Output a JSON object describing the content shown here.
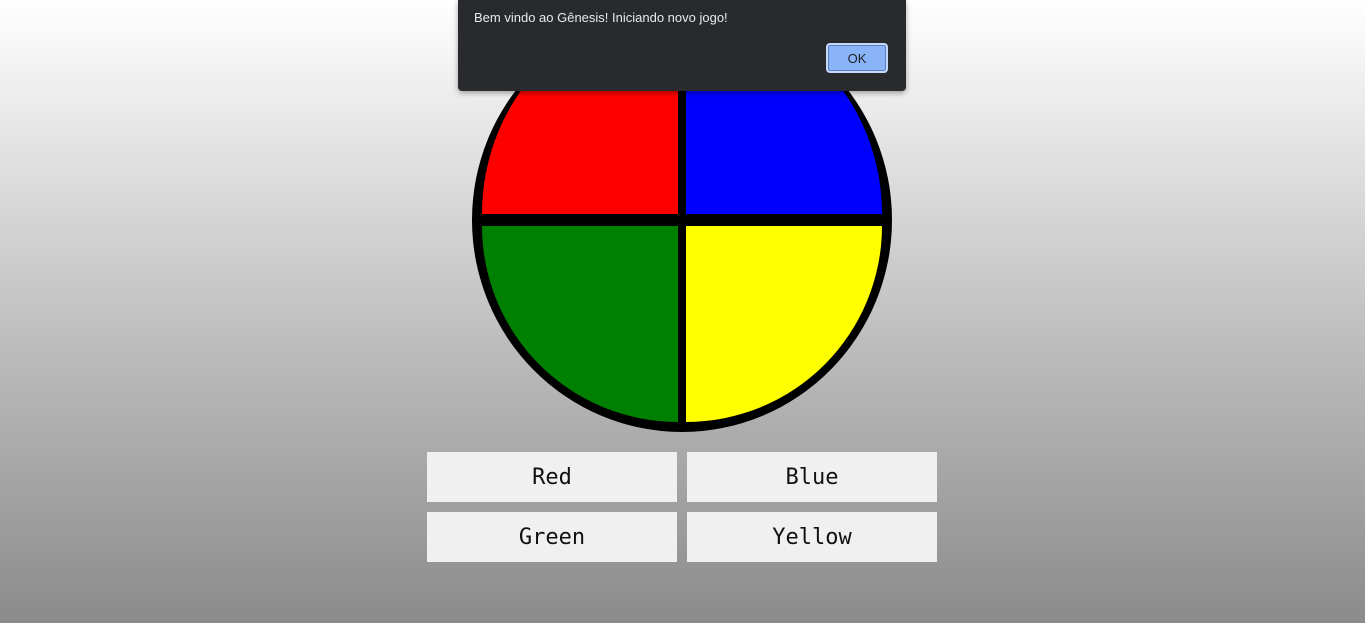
{
  "alert": {
    "message": "Bem vindo ao Gênesis! Iniciando novo jogo!",
    "ok_label": "OK"
  },
  "board": {
    "quadrants": [
      {
        "name": "red",
        "color": "#ff0000"
      },
      {
        "name": "blue",
        "color": "#0000ff"
      },
      {
        "name": "green",
        "color": "#008000"
      },
      {
        "name": "yellow",
        "color": "#ffff00"
      }
    ]
  },
  "buttons": {
    "red": "Red",
    "blue": "Blue",
    "green": "Green",
    "yellow": "Yellow"
  }
}
